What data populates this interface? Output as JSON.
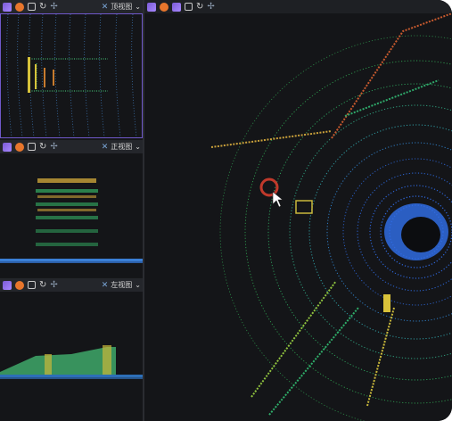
{
  "panels": {
    "top": {
      "view_label": "顶视图"
    },
    "front": {
      "view_label": "正视图"
    },
    "left": {
      "view_label": "左视图"
    }
  },
  "icons": {
    "toolbar": [
      "purple-cube-icon",
      "orange-sphere-icon",
      "box-select-icon",
      "refresh-icon",
      "axis-icon"
    ],
    "view_cross": "axis-icon",
    "dropdown": "chevron-down-icon"
  },
  "colors": {
    "frame_bg": "#151618",
    "toolbar_bg": "#24262b",
    "active_border": "#6f58c9",
    "accent_purple": "#8a6bea",
    "accent_orange": "#e8762c",
    "cursor_ring": "#c0392b"
  }
}
